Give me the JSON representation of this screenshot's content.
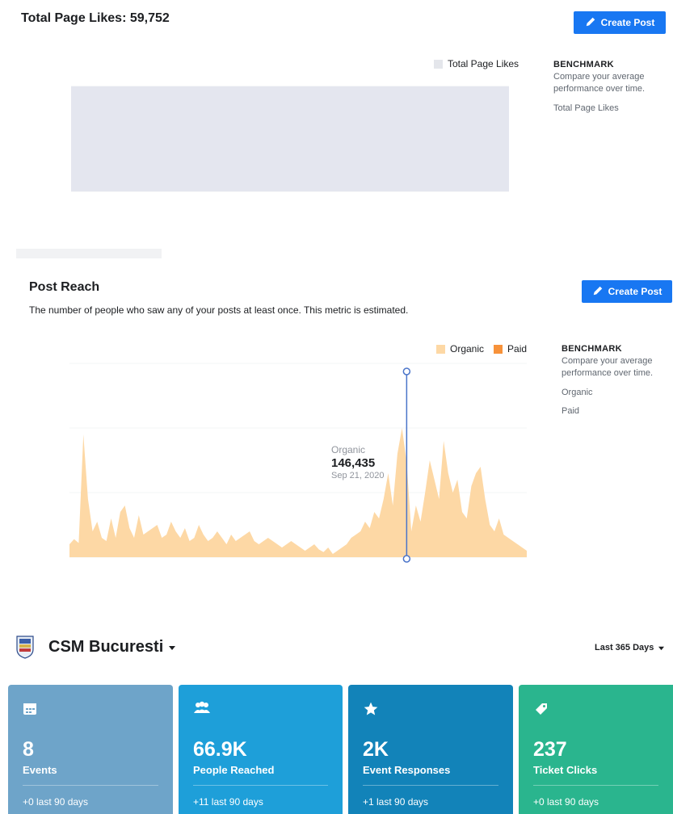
{
  "likes": {
    "title": "Total Page Likes: 59,752",
    "create_label": "Create Post",
    "legend_label": "Total Page Likes",
    "legend_color": "#e4e6eb",
    "benchmark_heading": "BENCHMARK",
    "benchmark_text": "Compare your average performance over time.",
    "benchmark_item": "Total Page Likes"
  },
  "reach": {
    "title": "Post Reach",
    "subtitle": "The number of people who saw any of your posts at least once. This metric is estimated.",
    "create_label": "Create Post",
    "legend_organic": "Organic",
    "legend_paid": "Paid",
    "benchmark_heading": "BENCHMARK",
    "benchmark_text": "Compare your average performance over time.",
    "benchmark_organic": "Organic",
    "benchmark_paid": "Paid",
    "tooltip": {
      "series": "Organic",
      "value": "146,435",
      "date": "Sep 21, 2020"
    }
  },
  "colors": {
    "organic": "#fdd8a5",
    "paid": "#f7923a",
    "button": "#1877f2",
    "cursor": "#4a74c9",
    "card_events": "#6ea4c9",
    "card_reach": "#1e9fd9",
    "card_responses": "#1283b9",
    "card_tickets": "#2ab58e"
  },
  "org": {
    "name": "CSM Bucuresti",
    "period": "Last 365 Days"
  },
  "cards": [
    {
      "icon": "calendar-icon",
      "value": "8",
      "label": "Events",
      "footer": "+0 last 90 days"
    },
    {
      "icon": "people-icon",
      "value": "66.9K",
      "label": "People Reached",
      "footer": "+11 last 90 days"
    },
    {
      "icon": "star-icon",
      "value": "2K",
      "label": "Event Responses",
      "footer": "+1 last 90 days"
    },
    {
      "icon": "ticket-icon",
      "value": "237",
      "label": "Ticket Clicks",
      "footer": "+0 last 90 days"
    }
  ],
  "chart_data": [
    {
      "type": "area",
      "series": [
        {
          "name": "Total Page Likes",
          "values": [
            59752,
            59752,
            59752,
            59752,
            59752,
            59752,
            59752,
            59752,
            59752,
            59752
          ]
        }
      ],
      "ylim": [
        59000,
        60500
      ]
    },
    {
      "type": "area",
      "series": [
        {
          "name": "Organic",
          "values": [
            20,
            28,
            22,
            190,
            90,
            40,
            55,
            30,
            25,
            60,
            30,
            70,
            80,
            45,
            30,
            65,
            35,
            40,
            45,
            50,
            30,
            35,
            55,
            40,
            30,
            45,
            25,
            30,
            50,
            35,
            25,
            30,
            40,
            30,
            20,
            35,
            25,
            30,
            35,
            40,
            25,
            20,
            25,
            30,
            25,
            20,
            15,
            20,
            25,
            20,
            15,
            10,
            15,
            20,
            12,
            8,
            15,
            5,
            10,
            15,
            20,
            30,
            35,
            40,
            55,
            45,
            70,
            60,
            90,
            130,
            80,
            160,
            200,
            146,
            40,
            80,
            55,
            100,
            150,
            120,
            90,
            180,
            130,
            100,
            120,
            70,
            60,
            110,
            130,
            140,
            90,
            50,
            40,
            60,
            35,
            30,
            25,
            20,
            15,
            10
          ]
        }
      ],
      "ylim": [
        0,
        300
      ]
    }
  ]
}
